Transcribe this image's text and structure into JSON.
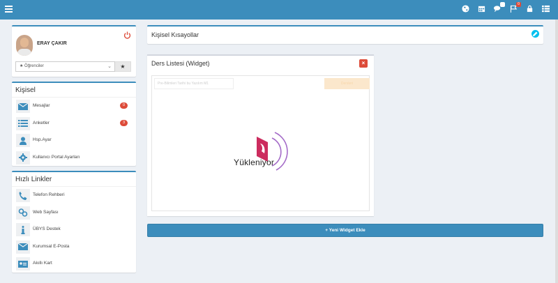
{
  "topbar": {
    "icons": [
      "globe-icon",
      "calendar-icon",
      "comments-icon",
      "flag-icon",
      "lock-icon",
      "grid-icon"
    ],
    "badges": {
      "comments": "",
      "flag": "0"
    }
  },
  "profile": {
    "username": "ERAY ÇAKIR",
    "role_select": "Öğrenciler",
    "role_caret": "⌄",
    "star": "★"
  },
  "kisisel": {
    "title": "Kişisel",
    "items": [
      {
        "label": "Mesajlar",
        "icon": "envelope-icon",
        "count": "0"
      },
      {
        "label": "Anketler",
        "icon": "list-icon",
        "count": "3"
      },
      {
        "label": "Hsp.Ayar",
        "icon": "user-icon"
      },
      {
        "label": "Kullanıcı Portal Ayarları",
        "icon": "gear-icon"
      }
    ]
  },
  "hizli": {
    "title": "Hızlı Linkler",
    "items": [
      {
        "label": "Telefon Rehberi",
        "icon": "phone-icon"
      },
      {
        "label": "Web Sayfası",
        "icon": "link-icon"
      },
      {
        "label": "ÜBYS Destek",
        "icon": "info-icon"
      },
      {
        "label": "Kurumsal E-Posta",
        "icon": "envelope-icon"
      },
      {
        "label": "Akıllı Kart",
        "icon": "id-card-icon"
      }
    ]
  },
  "shortcuts": {
    "title": "Kişisel Kısayollar"
  },
  "widget": {
    "title": "Ders Listesi (Widget)",
    "close": "×",
    "ghost_select": "Pre-Bilimleri Tarihi bu  Yazılım M1",
    "ghost_button": "Dersleri",
    "loading": "Yükleniyor"
  },
  "add_widget": {
    "label": "+ Yeni Widget Ekle"
  },
  "colors": {
    "primary": "#3c8dbc",
    "danger": "#dd4b39",
    "info": "#00c0ef",
    "background": "#ecf0f5"
  }
}
